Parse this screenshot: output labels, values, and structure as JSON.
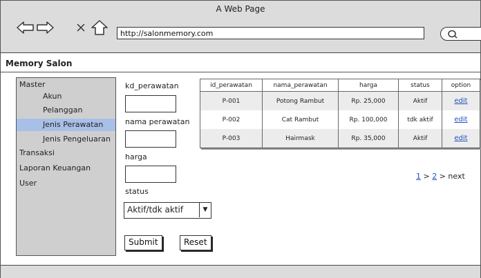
{
  "browser": {
    "window_title": "A Web Page",
    "url": "http://salonmemory.com"
  },
  "site": {
    "title": "Memory Salon"
  },
  "sidebar": {
    "items": [
      {
        "label": "Master"
      },
      {
        "label": "Akun"
      },
      {
        "label": "Pelanggan"
      },
      {
        "label": "Jenis Perawatan",
        "active": true
      },
      {
        "label": "Jenis Pengeluaran"
      },
      {
        "label": "Transaksi"
      },
      {
        "label": "Laporan Keuangan"
      },
      {
        "label": "User"
      }
    ]
  },
  "form": {
    "kd_label": "kd_perawatan",
    "nama_label": "nama perawatan",
    "harga_label": "harga",
    "status_label": "status",
    "status_value": "Aktif/tdk aktif",
    "submit_label": "Submit",
    "reset_label": "Reset"
  },
  "table": {
    "headers": [
      "id_perawatan",
      "nama_perawatan",
      "harga",
      "status",
      "option"
    ],
    "rows": [
      {
        "id": "P-001",
        "nama": "Potong Rambut",
        "harga": "Rp. 25,000",
        "status": "Aktif",
        "option": "edit"
      },
      {
        "id": "P-002",
        "nama": "Cat Rambut",
        "harga": "Rp. 100,000",
        "status": "tdk aktif",
        "option": "edit"
      },
      {
        "id": "P-003",
        "nama": "Hairmask",
        "harga": "Rp. 35,000",
        "status": "Aktif",
        "option": "edit"
      }
    ]
  },
  "pagination": {
    "page1": "1",
    "sep1": ">",
    "page2": "2",
    "next": "> next"
  }
}
